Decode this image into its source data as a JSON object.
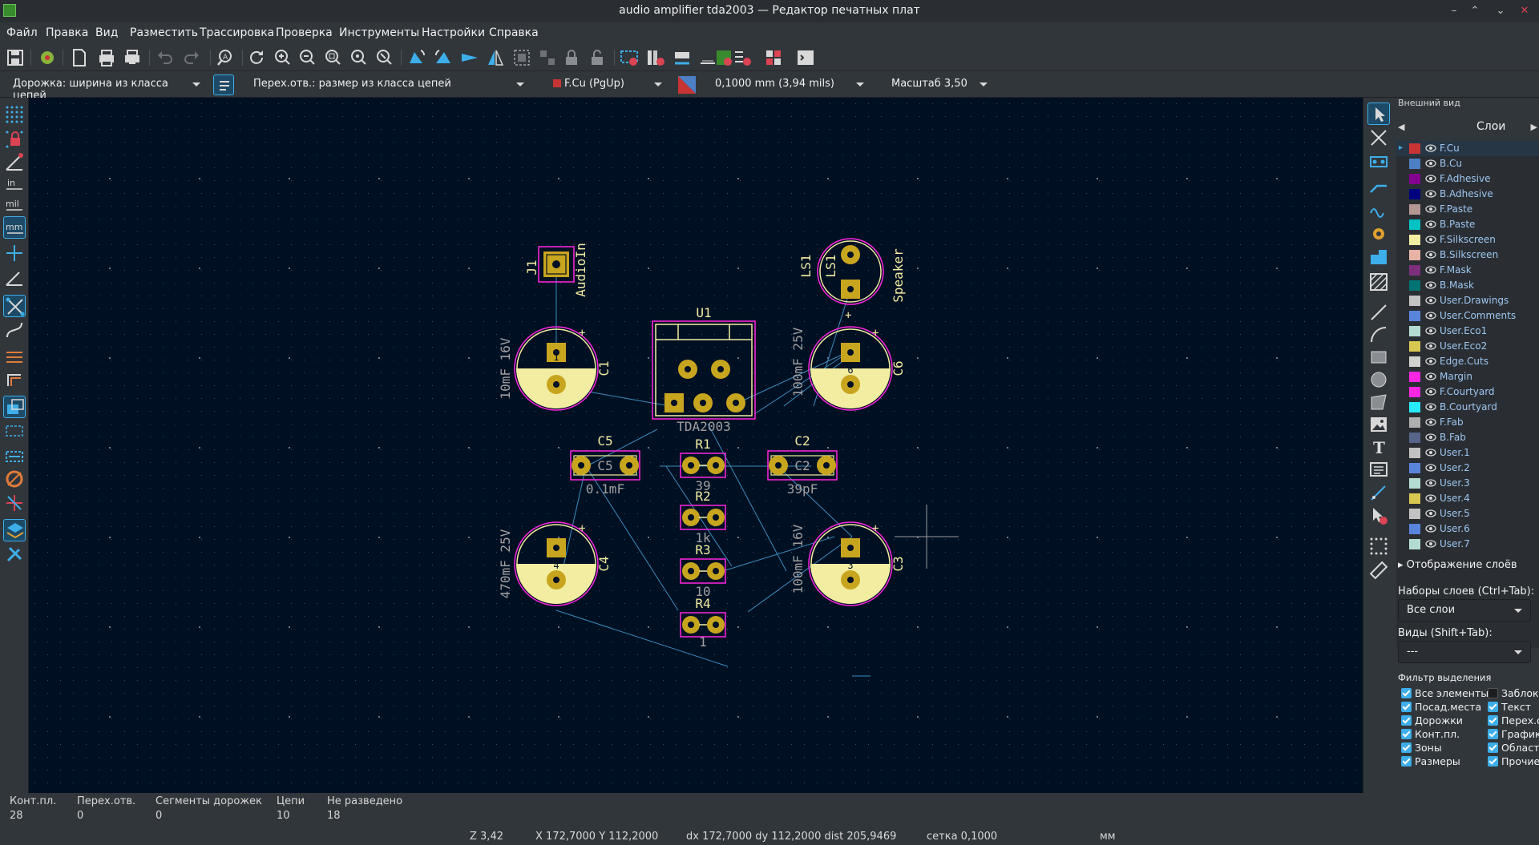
{
  "window": {
    "title": "audio amplifier tda2003 — Редактор печатных плат",
    "controls": [
      "–",
      "⌃",
      "⌄",
      "✕"
    ]
  },
  "menu": [
    "Файл",
    "Правка",
    "Вид",
    "Разместить",
    "Трассировка",
    "Проверка",
    "Инструменты",
    "Настройки",
    "Справка"
  ],
  "auxbar": {
    "track_width": "Дорожка: ширина из класса цепей",
    "via_size": "Перех.отв.: размер из класса цепей",
    "layer": "F.Cu (PgUp)",
    "grid": "0,1000 mm (3,94 mils)",
    "zoom": "Масштаб 3,50"
  },
  "board": {
    "components": {
      "J1": {
        "ref": "J1",
        "value": "AudioIn"
      },
      "LS1": {
        "ref": "LS1",
        "ref2": "LS1",
        "value": "Speaker"
      },
      "U1": {
        "ref": "U1",
        "value": "TDA2003"
      },
      "C1": {
        "ref": "C1",
        "value": "10mF 16V",
        "pad": "1"
      },
      "C6": {
        "ref": "C6",
        "value": "100mF 25V",
        "pad": "6"
      },
      "C5": {
        "ref": "C5",
        "ref2": "C5",
        "value": "0.1mF"
      },
      "C2": {
        "ref": "C2",
        "ref2": "C2",
        "value": "39pF"
      },
      "R1": {
        "ref": "R1",
        "value": "39"
      },
      "R2": {
        "ref": "R2",
        "value": "1k"
      },
      "R3": {
        "ref": "R3",
        "value": "10"
      },
      "R4": {
        "ref": "R4",
        "value": "1"
      },
      "C4": {
        "ref": "C4",
        "value": "470mF 25V",
        "pad": "4"
      },
      "C3": {
        "ref": "C3",
        "value": "100mF 16V",
        "pad": "3"
      }
    },
    "colors": {
      "background": "#001023",
      "pad": "#c8a51e",
      "silk": "#f2eda1",
      "courtyard": "#ff26e2",
      "ratsnest": "#3c8cbe"
    }
  },
  "panel": {
    "title": "Внешний вид",
    "tab": "Слои",
    "layers": [
      {
        "name": "F.Cu",
        "color": "#c83434"
      },
      {
        "name": "B.Cu",
        "color": "#4d7fc4"
      },
      {
        "name": "F.Adhesive",
        "color": "#84008f"
      },
      {
        "name": "B.Adhesive",
        "color": "#00007f"
      },
      {
        "name": "F.Paste",
        "color": "#b49693"
      },
      {
        "name": "B.Paste",
        "color": "#00c2c2"
      },
      {
        "name": "F.Silkscreen",
        "color": "#f2eda1"
      },
      {
        "name": "B.Silkscreen",
        "color": "#e8b2a7"
      },
      {
        "name": "F.Mask",
        "color": "#7d2f7d"
      },
      {
        "name": "B.Mask",
        "color": "#027373"
      },
      {
        "name": "User.Drawings",
        "color": "#c2c2c2"
      },
      {
        "name": "User.Comments",
        "color": "#5984dc"
      },
      {
        "name": "User.Eco1",
        "color": "#b4dbd2"
      },
      {
        "name": "User.Eco2",
        "color": "#d8c852"
      },
      {
        "name": "Edge.Cuts",
        "color": "#d0d2cd"
      },
      {
        "name": "Margin",
        "color": "#ff26e2"
      },
      {
        "name": "F.Courtyard",
        "color": "#ff26e2"
      },
      {
        "name": "B.Courtyard",
        "color": "#26e9ff"
      },
      {
        "name": "F.Fab",
        "color": "#afafaf"
      },
      {
        "name": "B.Fab",
        "color": "#58658a"
      },
      {
        "name": "User.1",
        "color": "#c2c2c2"
      },
      {
        "name": "User.2",
        "color": "#5984dc"
      },
      {
        "name": "User.3",
        "color": "#b4dbd2"
      },
      {
        "name": "User.4",
        "color": "#d8c852"
      },
      {
        "name": "User.5",
        "color": "#c2c2c2"
      },
      {
        "name": "User.6",
        "color": "#5984dc"
      },
      {
        "name": "User.7",
        "color": "#b4dbd2"
      }
    ],
    "display_layers": "Отображение слоёв",
    "presets_label": "Наборы слоев (Ctrl+Tab):",
    "presets_value": "Все слои",
    "views_label": "Виды (Shift+Tab):",
    "views_value": "---",
    "filter_title": "Фильтр выделения",
    "filter": [
      {
        "label": "Все элементы",
        "checked": true
      },
      {
        "label": "Заблок",
        "checked": false
      },
      {
        "label": "Посад.места",
        "checked": true
      },
      {
        "label": "Текст",
        "checked": true
      },
      {
        "label": "Дорожки",
        "checked": true
      },
      {
        "label": "Перех.о",
        "checked": true
      },
      {
        "label": "Конт.пл.",
        "checked": true
      },
      {
        "label": "Графика",
        "checked": true
      },
      {
        "label": "Зоны",
        "checked": true
      },
      {
        "label": "Области",
        "checked": true
      },
      {
        "label": "Размеры",
        "checked": true
      },
      {
        "label": "Прочие",
        "checked": true
      }
    ]
  },
  "messages": [
    {
      "label": "Конт.пл.",
      "value": "28"
    },
    {
      "label": "Перех.отв.",
      "value": "0"
    },
    {
      "label": "Сегменты дорожек",
      "value": "0"
    },
    {
      "label": "Цепи",
      "value": "10"
    },
    {
      "label": "Не разведено",
      "value": "18"
    }
  ],
  "status": {
    "zoom": "Z 3,42",
    "xy": "X 172,7000  Y 112,2000",
    "delta": "dx 172,7000  dy 112,2000  dist 205,9469",
    "grid": "сетка 0,1000",
    "units": "мм"
  }
}
